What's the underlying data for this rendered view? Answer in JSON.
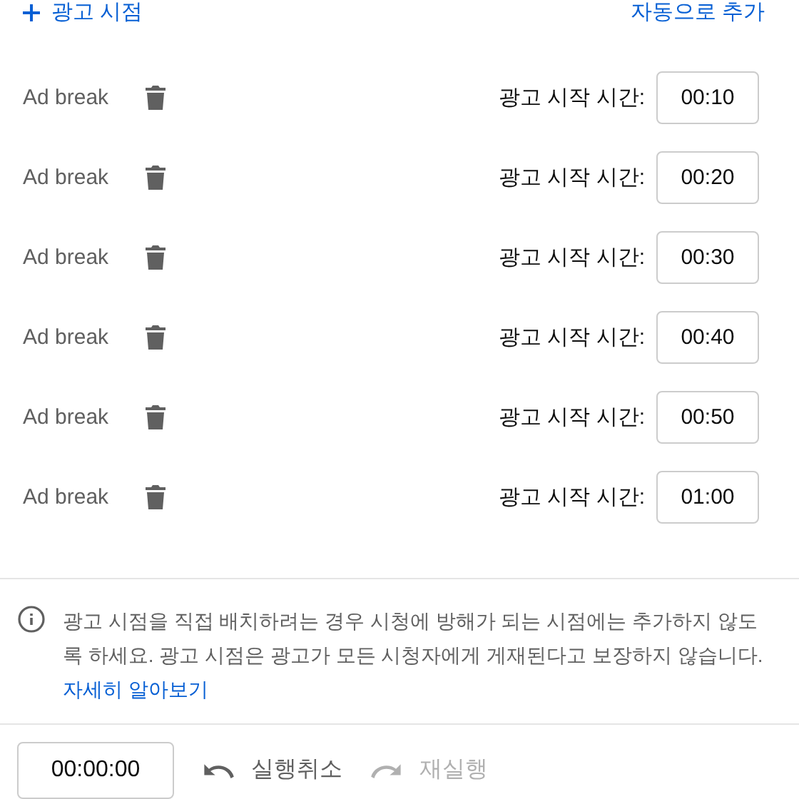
{
  "header": {
    "add_button": {
      "label": "광고 시점"
    },
    "auto_button": {
      "label": "자동으로 추가"
    }
  },
  "ad_breaks": [
    {
      "label": "Ad break",
      "start_label": "광고 시작 시간:",
      "time": "00:10"
    },
    {
      "label": "Ad break",
      "start_label": "광고 시작 시간:",
      "time": "00:20"
    },
    {
      "label": "Ad break",
      "start_label": "광고 시작 시간:",
      "time": "00:30"
    },
    {
      "label": "Ad break",
      "start_label": "광고 시작 시간:",
      "time": "00:40"
    },
    {
      "label": "Ad break",
      "start_label": "광고 시작 시간:",
      "time": "00:50"
    },
    {
      "label": "Ad break",
      "start_label": "광고 시작 시간:",
      "time": "01:00"
    }
  ],
  "notice": {
    "text": "광고 시점을 직접 배치하려는 경우 시청에 방해가 되는 시점에는 추가하지 않도록 하세요. 광고 시점은 광고가 모든 시청자에게 게재된다고 보장하지 않습니다.",
    "link": "자세히 알아보기"
  },
  "footer": {
    "timecode": "00:00:00",
    "undo": {
      "label": "실행취소",
      "disabled": false
    },
    "redo": {
      "label": "재실행",
      "disabled": true
    }
  }
}
